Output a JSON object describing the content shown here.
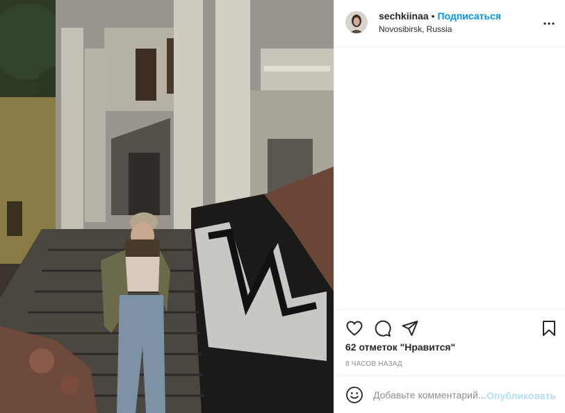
{
  "post": {
    "username": "sechkiinaa",
    "separator": "•",
    "follow_label": "Подписаться",
    "location": "Novosibirsk, Russia",
    "more_icon": "more-horizontal-icon"
  },
  "actions": {
    "like_icon": "heart-icon",
    "comment_icon": "comment-icon",
    "share_icon": "share-icon",
    "save_icon": "bookmark-icon",
    "likes_text": "62 отметок \"Нравится\"",
    "time_text": "8 часов назад"
  },
  "comment": {
    "emoji_icon": "emoji-icon",
    "placeholder": "Добавьте комментарий...",
    "publish_label": "Опубликовать"
  },
  "colors": {
    "accent": "#0095f6",
    "publish_disabled": "#b2dffc",
    "muted": "#8e8e8e",
    "border": "#efefef"
  }
}
